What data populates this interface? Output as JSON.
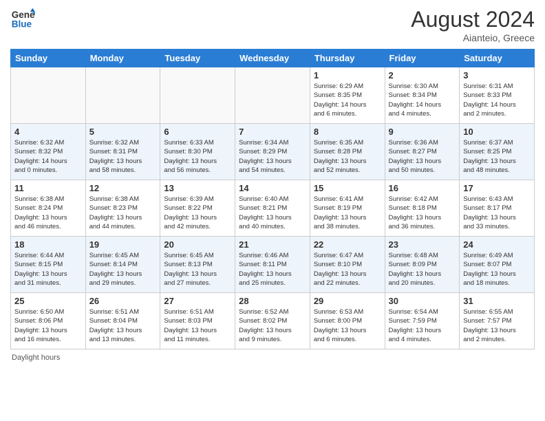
{
  "header": {
    "logo_line1": "General",
    "logo_line2": "Blue",
    "month_year": "August 2024",
    "location": "Aianteio, Greece"
  },
  "footer": {
    "daylight_label": "Daylight hours"
  },
  "weekdays": [
    "Sunday",
    "Monday",
    "Tuesday",
    "Wednesday",
    "Thursday",
    "Friday",
    "Saturday"
  ],
  "weeks": [
    [
      {
        "day": "",
        "info": ""
      },
      {
        "day": "",
        "info": ""
      },
      {
        "day": "",
        "info": ""
      },
      {
        "day": "",
        "info": ""
      },
      {
        "day": "1",
        "info": "Sunrise: 6:29 AM\nSunset: 8:35 PM\nDaylight: 14 hours\nand 6 minutes."
      },
      {
        "day": "2",
        "info": "Sunrise: 6:30 AM\nSunset: 8:34 PM\nDaylight: 14 hours\nand 4 minutes."
      },
      {
        "day": "3",
        "info": "Sunrise: 6:31 AM\nSunset: 8:33 PM\nDaylight: 14 hours\nand 2 minutes."
      }
    ],
    [
      {
        "day": "4",
        "info": "Sunrise: 6:32 AM\nSunset: 8:32 PM\nDaylight: 14 hours\nand 0 minutes."
      },
      {
        "day": "5",
        "info": "Sunrise: 6:32 AM\nSunset: 8:31 PM\nDaylight: 13 hours\nand 58 minutes."
      },
      {
        "day": "6",
        "info": "Sunrise: 6:33 AM\nSunset: 8:30 PM\nDaylight: 13 hours\nand 56 minutes."
      },
      {
        "day": "7",
        "info": "Sunrise: 6:34 AM\nSunset: 8:29 PM\nDaylight: 13 hours\nand 54 minutes."
      },
      {
        "day": "8",
        "info": "Sunrise: 6:35 AM\nSunset: 8:28 PM\nDaylight: 13 hours\nand 52 minutes."
      },
      {
        "day": "9",
        "info": "Sunrise: 6:36 AM\nSunset: 8:27 PM\nDaylight: 13 hours\nand 50 minutes."
      },
      {
        "day": "10",
        "info": "Sunrise: 6:37 AM\nSunset: 8:25 PM\nDaylight: 13 hours\nand 48 minutes."
      }
    ],
    [
      {
        "day": "11",
        "info": "Sunrise: 6:38 AM\nSunset: 8:24 PM\nDaylight: 13 hours\nand 46 minutes."
      },
      {
        "day": "12",
        "info": "Sunrise: 6:38 AM\nSunset: 8:23 PM\nDaylight: 13 hours\nand 44 minutes."
      },
      {
        "day": "13",
        "info": "Sunrise: 6:39 AM\nSunset: 8:22 PM\nDaylight: 13 hours\nand 42 minutes."
      },
      {
        "day": "14",
        "info": "Sunrise: 6:40 AM\nSunset: 8:21 PM\nDaylight: 13 hours\nand 40 minutes."
      },
      {
        "day": "15",
        "info": "Sunrise: 6:41 AM\nSunset: 8:19 PM\nDaylight: 13 hours\nand 38 minutes."
      },
      {
        "day": "16",
        "info": "Sunrise: 6:42 AM\nSunset: 8:18 PM\nDaylight: 13 hours\nand 36 minutes."
      },
      {
        "day": "17",
        "info": "Sunrise: 6:43 AM\nSunset: 8:17 PM\nDaylight: 13 hours\nand 33 minutes."
      }
    ],
    [
      {
        "day": "18",
        "info": "Sunrise: 6:44 AM\nSunset: 8:15 PM\nDaylight: 13 hours\nand 31 minutes."
      },
      {
        "day": "19",
        "info": "Sunrise: 6:45 AM\nSunset: 8:14 PM\nDaylight: 13 hours\nand 29 minutes."
      },
      {
        "day": "20",
        "info": "Sunrise: 6:45 AM\nSunset: 8:13 PM\nDaylight: 13 hours\nand 27 minutes."
      },
      {
        "day": "21",
        "info": "Sunrise: 6:46 AM\nSunset: 8:11 PM\nDaylight: 13 hours\nand 25 minutes."
      },
      {
        "day": "22",
        "info": "Sunrise: 6:47 AM\nSunset: 8:10 PM\nDaylight: 13 hours\nand 22 minutes."
      },
      {
        "day": "23",
        "info": "Sunrise: 6:48 AM\nSunset: 8:09 PM\nDaylight: 13 hours\nand 20 minutes."
      },
      {
        "day": "24",
        "info": "Sunrise: 6:49 AM\nSunset: 8:07 PM\nDaylight: 13 hours\nand 18 minutes."
      }
    ],
    [
      {
        "day": "25",
        "info": "Sunrise: 6:50 AM\nSunset: 8:06 PM\nDaylight: 13 hours\nand 16 minutes."
      },
      {
        "day": "26",
        "info": "Sunrise: 6:51 AM\nSunset: 8:04 PM\nDaylight: 13 hours\nand 13 minutes."
      },
      {
        "day": "27",
        "info": "Sunrise: 6:51 AM\nSunset: 8:03 PM\nDaylight: 13 hours\nand 11 minutes."
      },
      {
        "day": "28",
        "info": "Sunrise: 6:52 AM\nSunset: 8:02 PM\nDaylight: 13 hours\nand 9 minutes."
      },
      {
        "day": "29",
        "info": "Sunrise: 6:53 AM\nSunset: 8:00 PM\nDaylight: 13 hours\nand 6 minutes."
      },
      {
        "day": "30",
        "info": "Sunrise: 6:54 AM\nSunset: 7:59 PM\nDaylight: 13 hours\nand 4 minutes."
      },
      {
        "day": "31",
        "info": "Sunrise: 6:55 AM\nSunset: 7:57 PM\nDaylight: 13 hours\nand 2 minutes."
      }
    ]
  ]
}
